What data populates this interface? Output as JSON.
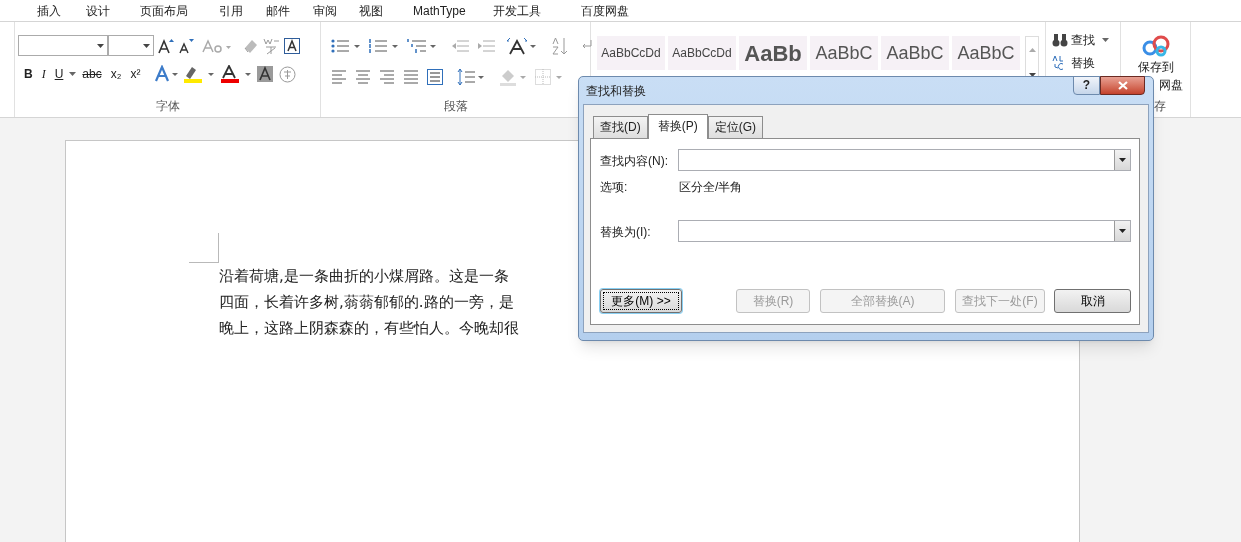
{
  "menu_tabs": [
    {
      "label": "插入",
      "selected": false
    },
    {
      "label": "设计",
      "selected": false
    },
    {
      "label": "页面布局",
      "selected": false
    },
    {
      "label": "引用",
      "selected": false
    },
    {
      "label": "邮件",
      "selected": false
    },
    {
      "label": "审阅",
      "selected": false
    },
    {
      "label": "视图",
      "selected": false
    },
    {
      "label": "MathType",
      "selected": false
    },
    {
      "label": "开发工具",
      "selected": false
    },
    {
      "label": "百度网盘",
      "selected": false
    }
  ],
  "ribbon": {
    "font_group": {
      "label": "字体",
      "format_buttons": [
        "B",
        "I",
        "U",
        "abc",
        "x₂",
        "x²"
      ]
    },
    "paragraph_group": {
      "label": "段落"
    },
    "styles": [
      {
        "preview": "AaBbCcDd",
        "kind": "small"
      },
      {
        "preview": "AaBbCcDd",
        "kind": "small"
      },
      {
        "preview": "AaBb",
        "kind": "heading"
      },
      {
        "preview": "AaBbC",
        "kind": "large"
      },
      {
        "preview": "AaBbC",
        "kind": "large"
      },
      {
        "preview": "AaBbC",
        "kind": "large"
      }
    ],
    "editing": [
      {
        "label": "查找",
        "kind": "find"
      },
      {
        "label": "替换",
        "kind": "replace"
      }
    ],
    "save": {
      "line1": "保存到",
      "line2": "网盘",
      "group_label": "存"
    }
  },
  "document": {
    "lines": [
      "沿着荷塘,是一条曲折的小煤屑路。这是一条",
      "四面，长着许多树,蓊蓊郁郁的.路的一旁，是",
      "晚上，这路上阴森森的，有些怕人。今晚却很"
    ]
  },
  "dialog": {
    "title": "查找和替换",
    "help": "?",
    "tabs": [
      {
        "label": "查找(D)",
        "selected": false
      },
      {
        "label": "替换(P)",
        "selected": true
      },
      {
        "label": "定位(G)",
        "selected": false
      }
    ],
    "find_label": "查找内容(N):",
    "options_label": "选项:",
    "options_value": "区分全/半角",
    "replace_label": "替换为(I):",
    "buttons": [
      {
        "label": "更多(M) >>",
        "disabled": false,
        "focused": true
      },
      {
        "label": "替换(R)",
        "disabled": true,
        "focused": false
      },
      {
        "label": "全部替换(A)",
        "disabled": true,
        "focused": false
      },
      {
        "label": "查找下一处(F)",
        "disabled": true,
        "focused": false
      },
      {
        "label": "取消",
        "disabled": false,
        "focused": false
      }
    ]
  }
}
